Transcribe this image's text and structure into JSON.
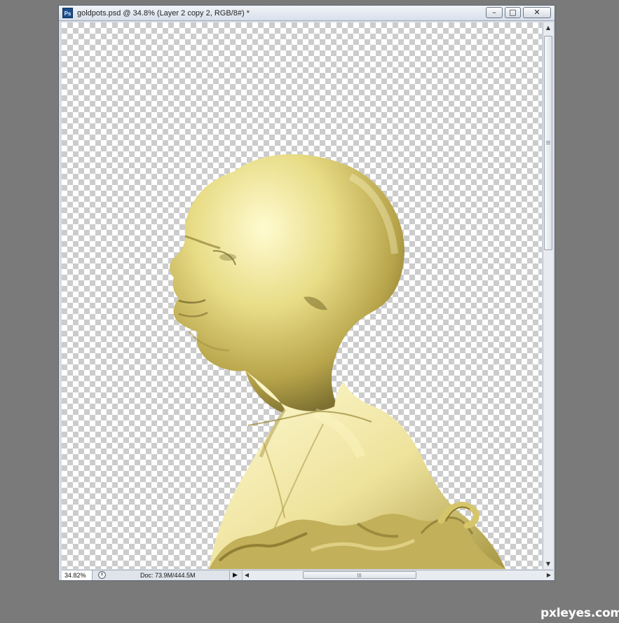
{
  "window": {
    "app_icon_text": "Ps",
    "title": "goldpots.psd @ 34.8% (Layer 2 copy 2, RGB/8#) *",
    "buttons": {
      "minimize_icon": "minimize-icon",
      "restore_icon": "restore-icon",
      "close_icon": "close-icon"
    }
  },
  "canvas": {
    "background": "transparency-checkerboard",
    "content": "gold-tinted-bust-profile"
  },
  "status_bar": {
    "zoom": "34.82%",
    "doc_info": "Doc: 73.9M/444.5M",
    "menu_arrow": "▶"
  },
  "watermark": {
    "text": "pxleyes.com"
  },
  "colors": {
    "desktop": "#7a7a7a",
    "gold_light": "#f3ea9c",
    "gold_mid": "#d8c86a",
    "gold_dark": "#9d8d3d"
  }
}
